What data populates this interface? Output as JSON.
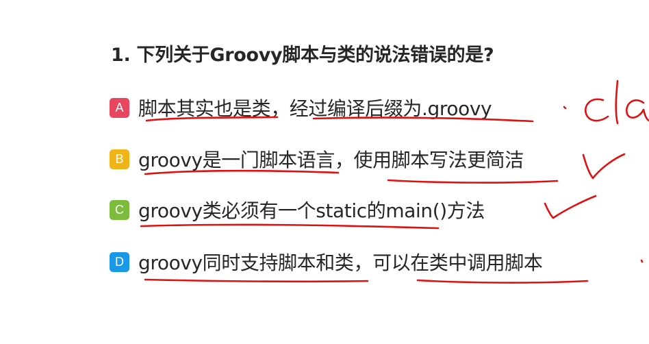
{
  "question": {
    "title": "1. 下列关于Groovy脚本与类的说法错误的是?"
  },
  "options": [
    {
      "letter": "A",
      "text": "脚本其实也是类，经过编译后缀为.groovy",
      "color": "#e8455f"
    },
    {
      "letter": "B",
      "text": "groovy是一门脚本语言，使用脚本写法更简洁",
      "color": "#f0b419"
    },
    {
      "letter": "C",
      "text": "groovy类必须有一个static的main()方法",
      "color": "#7dbb3c"
    },
    {
      "letter": "D",
      "text": "groovy同时支持脚本和类，可以在类中调用脚本",
      "color": "#1a98e8"
    }
  ],
  "annotations": {
    "ink_color": "#e01010",
    "marks": [
      "underline",
      "checkmark",
      "handwriting-cla",
      "dot"
    ]
  }
}
